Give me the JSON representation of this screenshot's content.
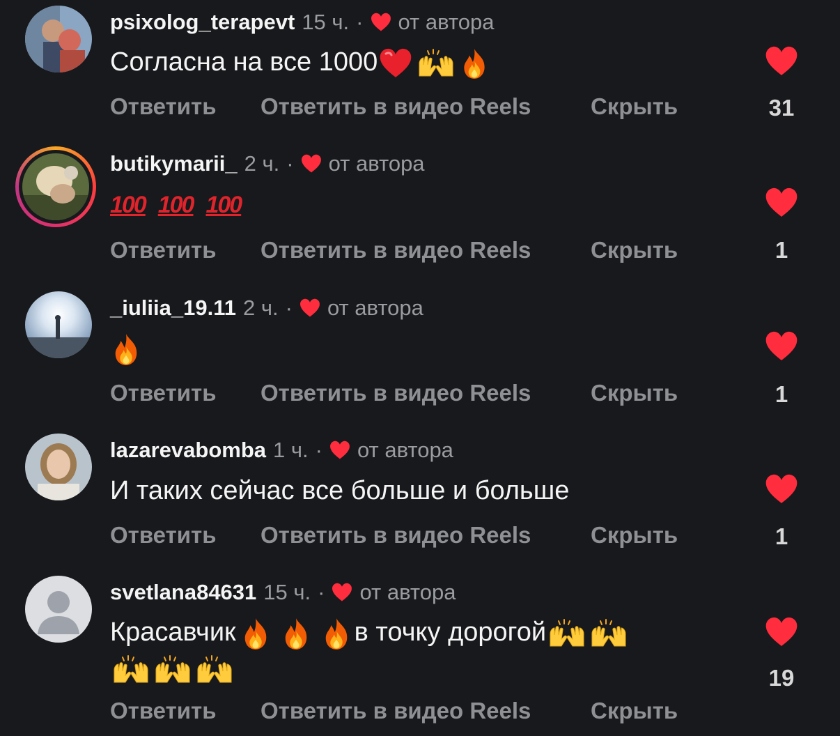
{
  "actions": {
    "reply": "Ответить",
    "reply_reels": "Ответить в видео Reels",
    "hide": "Скрыть"
  },
  "colors": {
    "background": "#17191c",
    "heart": "#ff2d3d",
    "muted_text": "#9a9ca0"
  },
  "comments": [
    {
      "username": "psixolog_terapevt",
      "time": "15 ч.",
      "dot": "·",
      "liked_by_author": "от автора",
      "text": "Согласна на все 1000",
      "emojis": [
        "red-heart",
        "raising-hands",
        "fire"
      ],
      "likes": "31"
    },
    {
      "username": "butikymarii_",
      "time": "2 ч.",
      "dot": "·",
      "liked_by_author": "от автора",
      "emojis": [
        "hundred-points",
        "hundred-points",
        "hundred-points"
      ],
      "hundred_glyph": "100",
      "likes": "1"
    },
    {
      "username": "_iuliia_19.11",
      "time": "2 ч.",
      "dot": "·",
      "liked_by_author": "от автора",
      "emojis": [
        "fire"
      ],
      "likes": "1"
    },
    {
      "username": "lazarevabomba",
      "time": "1 ч.",
      "dot": "·",
      "liked_by_author": "от автора",
      "text": "И таких сейчас все больше и больше",
      "likes": "1"
    },
    {
      "username": "svetlana84631",
      "time": "15 ч.",
      "dot": "·",
      "liked_by_author": "от автора",
      "text_part1": "Красавчик",
      "text_part2": "в точку дорогой",
      "emojis": [
        "fire",
        "fire",
        "fire",
        "raising-hands",
        "raising-hands",
        "raising-hands",
        "raising-hands",
        "raising-hands"
      ],
      "likes": "19"
    }
  ]
}
